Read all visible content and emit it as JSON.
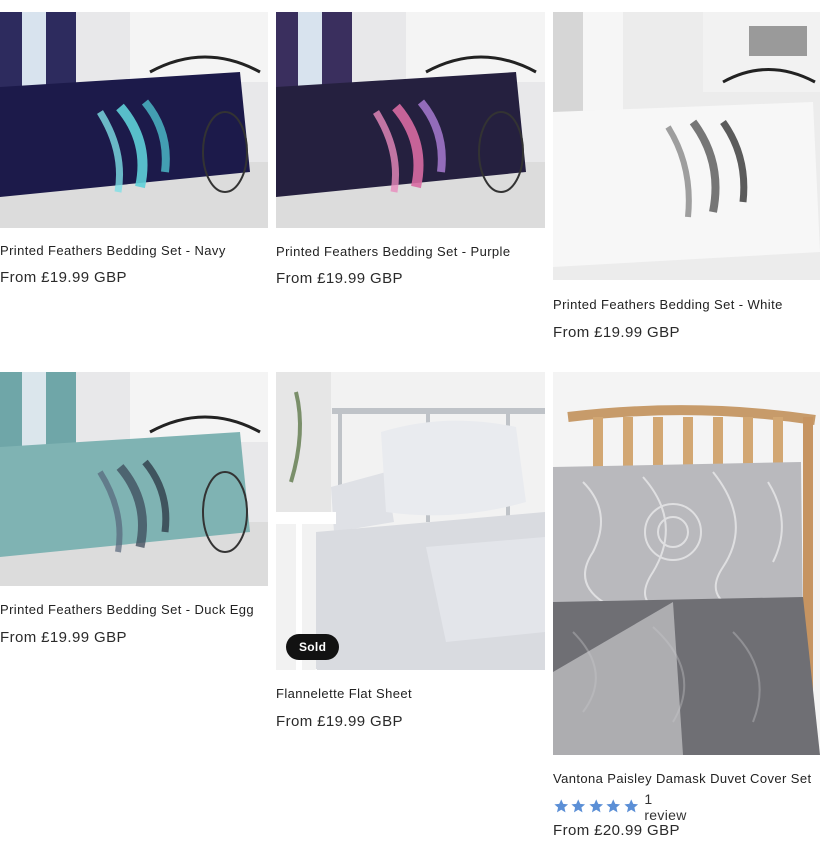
{
  "products": [
    {
      "title": "Printed Feathers Bedding Set - Navy",
      "price": "From £19.99 GBP",
      "color": "#1c1a4a",
      "accent": "#5fd0d8"
    },
    {
      "title": "Printed Feathers Bedding Set - Purple",
      "price": "From £19.99 GBP",
      "color": "#25203f",
      "accent": "#d86aa2"
    },
    {
      "title": "Printed Feathers Bedding Set - White",
      "price": "From £19.99 GBP",
      "color": "#efefef",
      "accent": "#555555"
    },
    {
      "title": "Printed Feathers Bedding Set - Duck Egg",
      "price": "From £19.99 GBP",
      "color": "#7fb3b3",
      "accent": "#3c4a5a"
    },
    {
      "title": "Flannelette Flat Sheet",
      "price": "From £19.99 GBP",
      "color": "#d9dbe0",
      "badge": "Sold out"
    },
    {
      "title": "Vantona Paisley Damask Duvet Cover Set",
      "price": "From £20.99 GBP",
      "color": "#9a9a9e",
      "rating": {
        "stars": 5,
        "review_text": "1 review",
        "star_color": "#5b8fd6"
      }
    }
  ]
}
